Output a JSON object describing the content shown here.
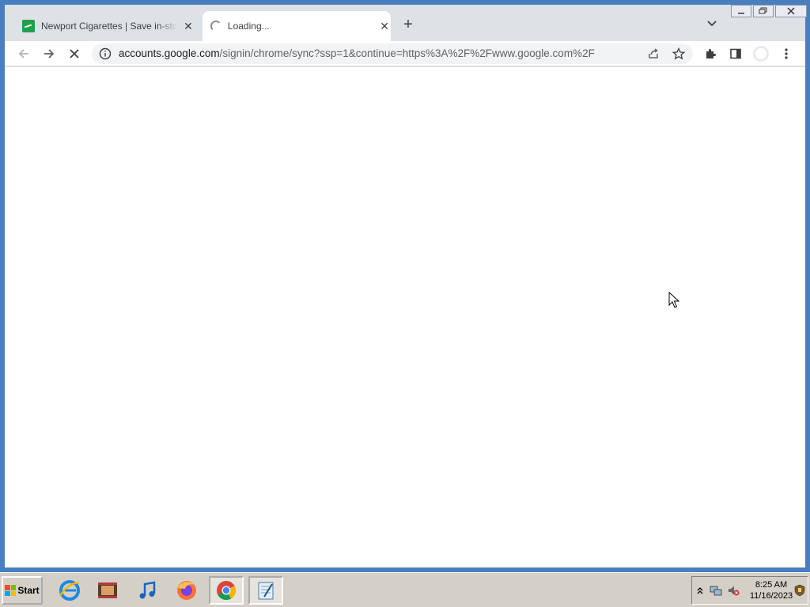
{
  "tabs": [
    {
      "title": "Newport Cigarettes | Save in-store",
      "favicon": "newport-favicon-icon"
    },
    {
      "title": "Loading...",
      "favicon": "loading-spinner-icon"
    }
  ],
  "toolbar": {
    "url": "accounts.google.com/signin/chrome/sync?ssp=1&continue=https%3A%2F%2Fwww.google.com%2F",
    "url_domain": "accounts.google.com",
    "url_path": "/signin/chrome/sync?ssp=1&continue=https%3A%2F%2Fwww.google.com%2F"
  },
  "taskbar": {
    "start_label": "Start",
    "apps": [
      "internet-explorer-icon",
      "film-strip-icon",
      "itunes-icon",
      "firefox-icon",
      "chrome-icon",
      "notepad-icon"
    ],
    "clock_time": "8:25 AM",
    "clock_date": "11/16/2023"
  },
  "colors": {
    "accent": "#1a73e8",
    "tab_strip": "#dee1e6",
    "taskbar": "#d4d0c8"
  }
}
